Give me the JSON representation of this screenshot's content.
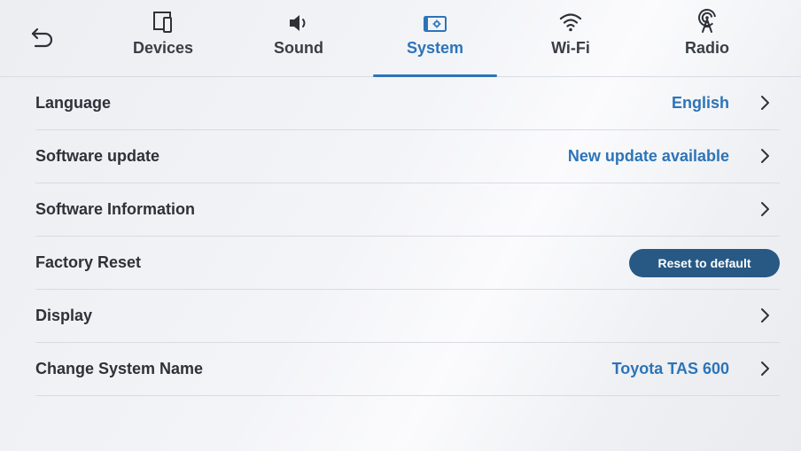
{
  "header": {
    "back_icon": "back-arrow-icon",
    "tabs": [
      {
        "label": "Devices",
        "icon": "devices-icon",
        "active": false
      },
      {
        "label": "Sound",
        "icon": "speaker-icon",
        "active": false
      },
      {
        "label": "System",
        "icon": "system-icon",
        "active": true
      },
      {
        "label": "Wi-Fi",
        "icon": "wifi-icon",
        "active": false
      },
      {
        "label": "Radio",
        "icon": "radio-icon",
        "active": false
      }
    ]
  },
  "rows": [
    {
      "title": "Language",
      "value": "English"
    },
    {
      "title": "Software update",
      "value": "New update available"
    },
    {
      "title": "Software Information",
      "value": ""
    },
    {
      "title": "Factory Reset",
      "button": "Reset to default"
    },
    {
      "title": "Display",
      "value": ""
    },
    {
      "title": "Change System Name",
      "value": "Toyota TAS 600"
    }
  ],
  "colors": {
    "accent": "#2c74b8",
    "button_bg": "#285985",
    "text": "#2e3138",
    "divider": "#d8dbe2"
  }
}
